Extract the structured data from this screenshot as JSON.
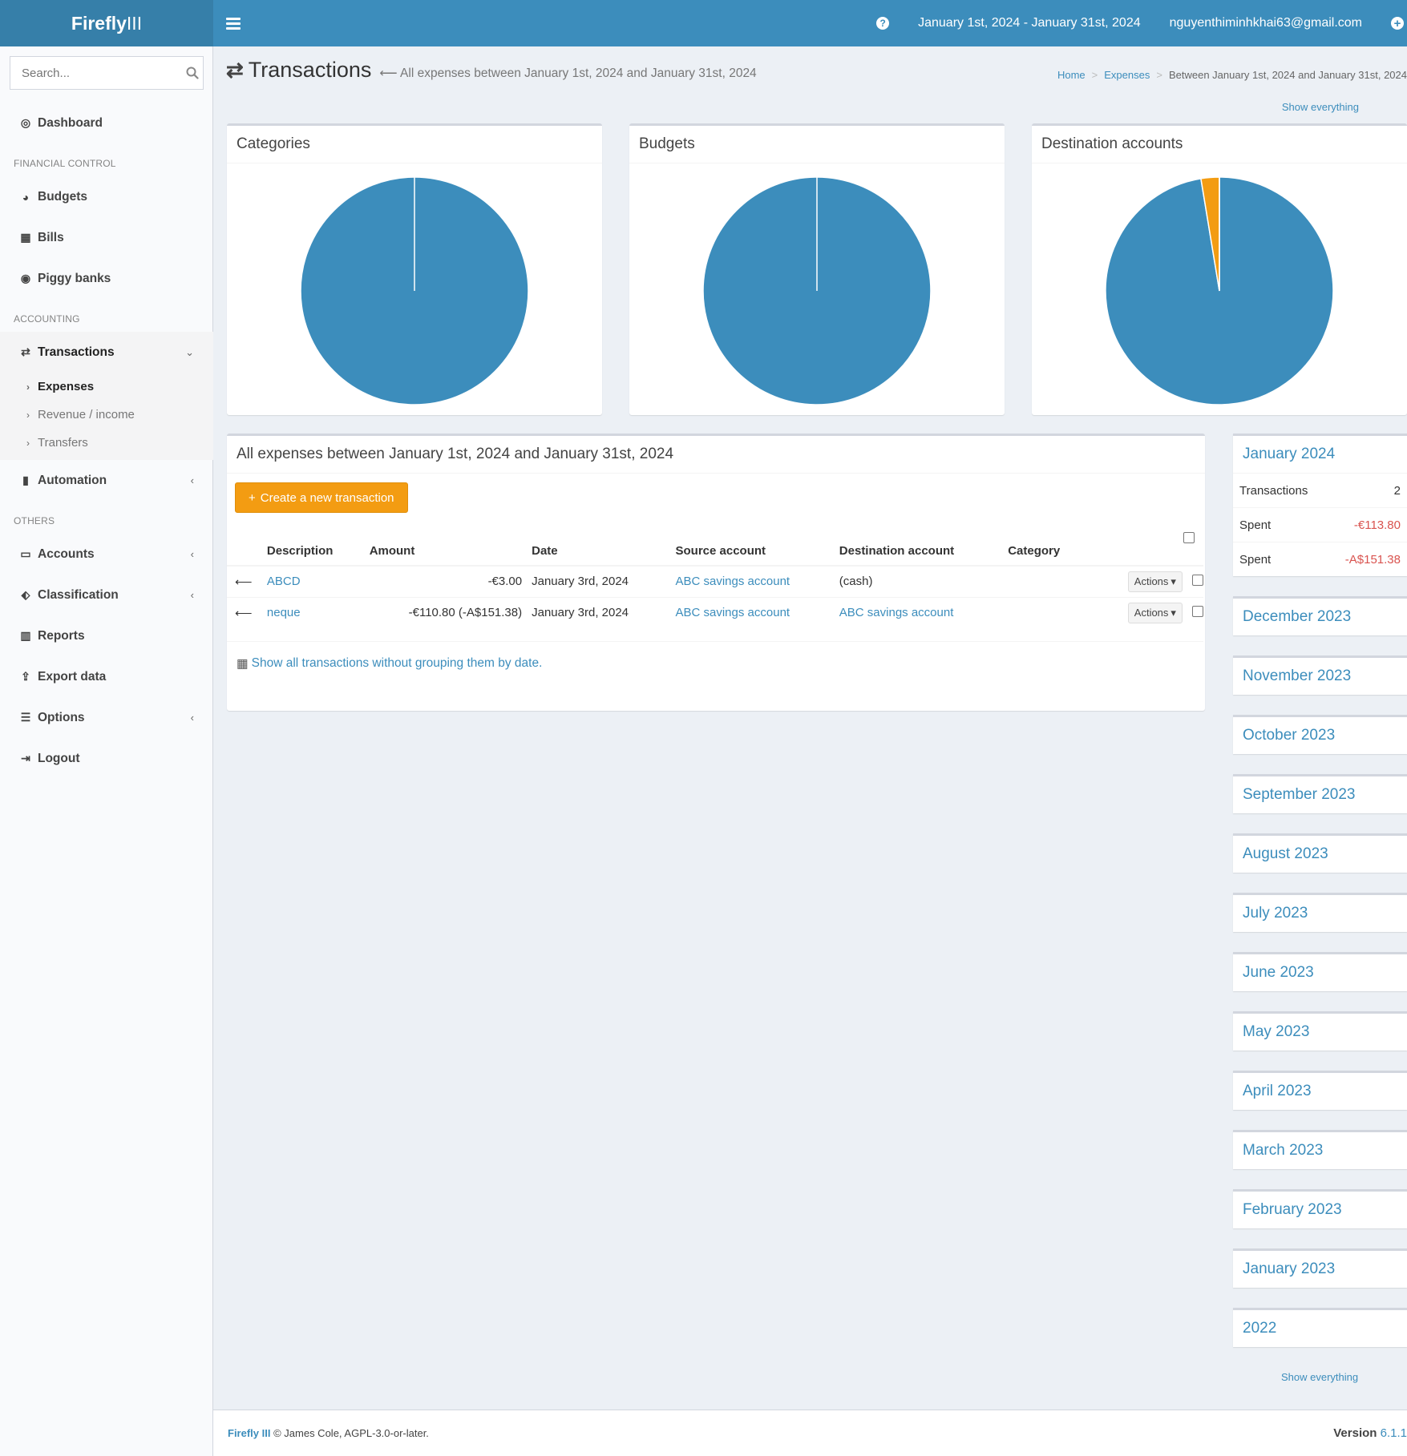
{
  "header": {
    "logo_bold": "Firefly",
    "logo_rest": "III",
    "date_range": "January 1st, 2024 - January 31st, 2024",
    "user_email": "nguyenthiminhkhai63@gmail.com"
  },
  "sidebar": {
    "search_placeholder": "Search...",
    "dashboard": "Dashboard",
    "financial_control": "FINANCIAL CONTROL",
    "budgets": "Budgets",
    "bills": "Bills",
    "piggy_banks": "Piggy banks",
    "accounting": "ACCOUNTING",
    "transactions": "Transactions",
    "expenses": "Expenses",
    "revenue": "Revenue / income",
    "transfers": "Transfers",
    "automation": "Automation",
    "others": "OTHERS",
    "accounts": "Accounts",
    "classification": "Classification",
    "reports": "Reports",
    "export_data": "Export data",
    "options": "Options",
    "logout": "Logout"
  },
  "page": {
    "title": "Transactions",
    "subtitle": "All expenses between January 1st, 2024 and January 31st, 2024",
    "breadcrumb": [
      "Home",
      "Expenses",
      "Between January 1st, 2024 and January 31st, 2024"
    ],
    "show_everything": "Show everything"
  },
  "charts": {
    "categories_title": "Categories",
    "budgets_title": "Budgets",
    "destination_title": "Destination accounts"
  },
  "chart_data": [
    {
      "type": "pie",
      "title": "Categories",
      "slices": [
        1.0
      ],
      "colors": [
        "#3c8dbc"
      ]
    },
    {
      "type": "pie",
      "title": "Budgets",
      "slices": [
        1.0
      ],
      "colors": [
        "#3c8dbc"
      ]
    },
    {
      "type": "pie",
      "title": "Destination accounts",
      "slices": [
        0.974,
        0.026
      ],
      "colors": [
        "#3c8dbc",
        "#f39c12"
      ]
    }
  ],
  "list": {
    "title": "All expenses between January 1st, 2024 and January 31st, 2024",
    "create_button": "Create a new transaction",
    "columns": [
      "Description",
      "Amount",
      "Date",
      "Source account",
      "Destination account",
      "Category"
    ],
    "rows": [
      {
        "description": "ABCD",
        "amount": "-€3.00",
        "date": "January 3rd, 2024",
        "source": "ABC savings account",
        "destination": "(cash)",
        "category": ""
      },
      {
        "description": "neque",
        "amount": "-€110.80 (-A$151.38)",
        "date": "January 3rd, 2024",
        "source": "ABC savings account",
        "destination": "ABC savings account",
        "category": ""
      }
    ],
    "actions_label": "Actions",
    "footer_link": "Show all transactions without grouping them by date."
  },
  "periods": {
    "current": {
      "title": "January 2024",
      "transactions_label": "Transactions",
      "transactions_value": "2",
      "spent_label": "Spent",
      "spent_eur": "-€113.80",
      "spent_aud": "-A$151.38"
    },
    "others": [
      "December 2023",
      "November 2023",
      "October 2023",
      "September 2023",
      "August 2023",
      "July 2023",
      "June 2023",
      "May 2023",
      "April 2023",
      "March 2023",
      "February 2023",
      "January 2023",
      "2022"
    ],
    "show_everything": "Show everything"
  },
  "footer": {
    "brand": "Firefly III",
    "copyright": "© James Cole, AGPL-3.0-or-later.",
    "version_label": "Version",
    "version": "6.1.1"
  }
}
